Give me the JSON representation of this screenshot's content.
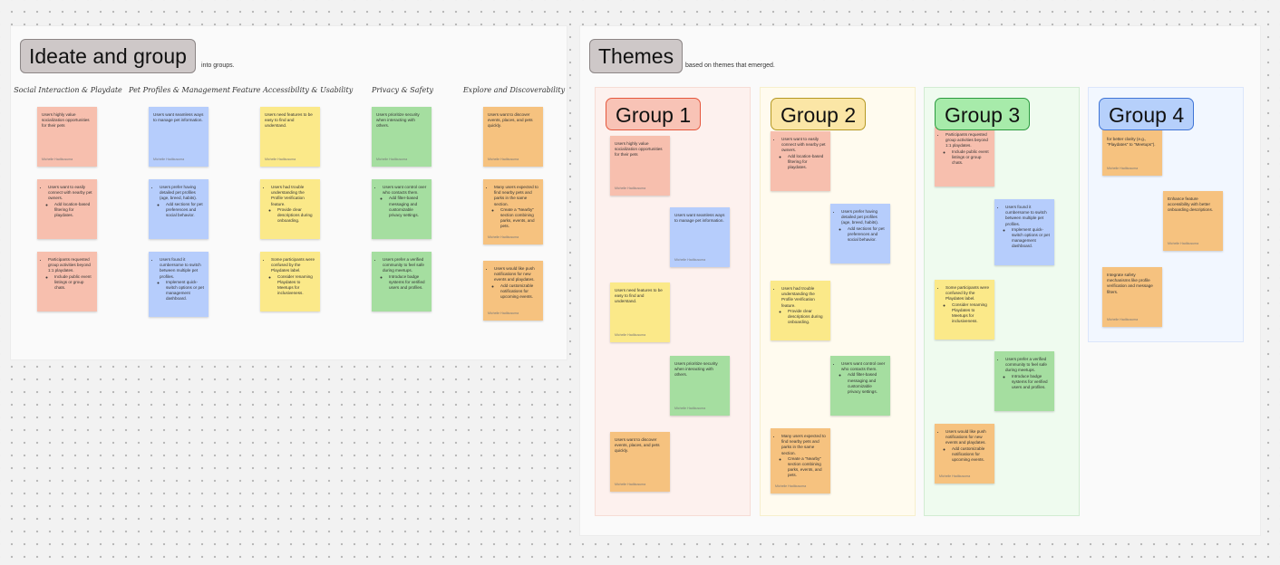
{
  "ideate": {
    "title": "Ideate and group",
    "description_visible": "into groups.",
    "columns": [
      "Social Interaction & Playdate",
      "Pet Profiles & Management",
      "Feature Accessibility & Usability",
      "Privacy & Safety",
      "Explore and Discoverability"
    ],
    "notes": {
      "red_value_social": "Users highly value socialization opportunities for their pets",
      "red_nearby": "Users want to easily connect with nearby pet owners.",
      "red_nearby_sub": "Add location-based filtering for playdates.",
      "red_requested": "Participants requested group activities beyond 1:1 playdates.",
      "red_requested_sub": "Include public event listings or group chats.",
      "blue_seamless": "Users want seamless ways to manage pet information.",
      "blue_detailed": "Users prefer having detailed pet profiles (age, breed, habits).",
      "blue_detailed_sub": "Add sections for pet preferences and social behavior.",
      "blue_switch": "Users found it cumbersome to switch between multiple pet profiles.",
      "blue_switch_sub": "Implement quick-switch options or pet management dashboard.",
      "yellow_easy": "Users need features to be easy to find and understand.",
      "yellow_trouble": "Users had trouble understanding the Profile Verification feature.",
      "yellow_trouble_sub": "Provide clear descriptions during onboarding.",
      "yellow_confused": "Some participants were confused by the Playdates label.",
      "yellow_confused_sub": "Consider renaming Playdates to Meetups for inclusiveness.",
      "green_security": "Users prioritize security when interacting with others.",
      "green_control": "Users want control over who contacts them.",
      "green_control_sub": "Add filter-based messaging and customizable privacy settings.",
      "green_verified": "Users prefer a verified community to feel safe during meetups.",
      "green_verified_sub": "Introduce badge systems for verified users and profiles.",
      "orange_discover": "Users want to discover events, places, and pets quickly.",
      "orange_nearby": "Many users expected to find nearby pets and parks in the same section.",
      "orange_nearby_sub": "Create a \"Nearby\" section combining parks, events, and pets.",
      "orange_push": "Users would like push notifications for new events and playdates.",
      "orange_push_sub": "Add customizable notifications for upcoming events.",
      "orange_clarity": "for better clarity (e.g., \"Playdates\" to \"Meetups\").",
      "orange_feature": "Enhance feature accessibility with better onboarding descriptions.",
      "orange_safety": "Integrate safety mechanisms like profile verification and message filters."
    },
    "author": "Michelle Hadikusuma"
  },
  "themes": {
    "title": "Themes",
    "description_visible": "based on themes that emerged.",
    "groups": [
      "Group 1",
      "Group 2",
      "Group 3",
      "Group 4"
    ]
  },
  "colors": {
    "red": "#f7bfae",
    "blue": "#b6cdfc",
    "yellow": "#fbe989",
    "green": "#a5dea0",
    "orange": "#f6c27f"
  }
}
